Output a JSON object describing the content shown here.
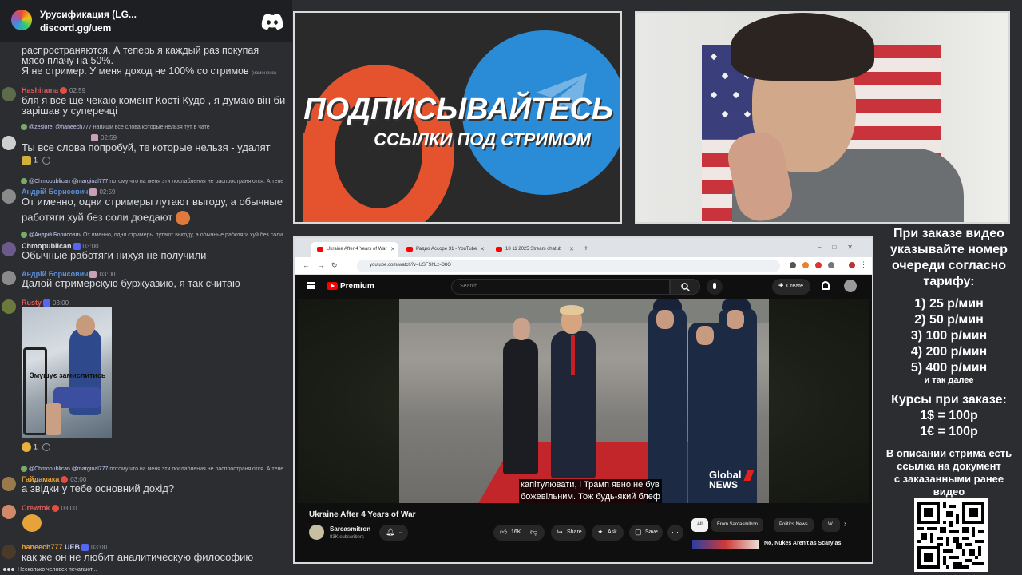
{
  "discord": {
    "server_name": "Урусификация (LG...",
    "invite": "discord.gg/uem"
  },
  "chat": {
    "cut_msg_line1": "распространяются. А теперь я каждый раз покупая",
    "cut_msg_line2": "мясо плачу на 50%.",
    "cut_msg_line3": "Я не стример. У меня доход не 100% со стримов",
    "cut_msg_edited": "(изменено)",
    "messages": [
      {
        "user": "Hashirama",
        "time": "02:59",
        "user_color": "#e05a5a",
        "text1": "бля я все ще чекаю комент Кості Кудо , я думаю він би",
        "text2": "зарішав у суперечці"
      },
      {
        "reply_user": "@zeslorel",
        "reply_mention": "@haneech777",
        "reply_text": "напиши все слова которые нельзя тут в чате",
        "time": "02:59",
        "text1": "Ты все слова попробуй, те которые нельзя - удалят",
        "reaction_count": "1"
      },
      {
        "reply_user": "@Chmopublican",
        "reply_mention": "@marginal777",
        "reply_text": "потому что на меня эти послабления не распространяются. А тепе",
        "user": "Андрій Борисович",
        "time": "02:59",
        "user_color": "#5a8fd8",
        "text1": "От именно, одни стримеры лутают выгоду, а обычные",
        "text2": "работяги хуй без соли доедают"
      },
      {
        "reply_user": "@Андрій Борисович",
        "reply_text": "От именно, одни стримеры лутают выгоду, а обычные работяги хуй без соли",
        "user": "Chmopublican",
        "time": "03:00",
        "user_color": "#dbdee1",
        "text1": "Обычные работяги нихуя не получили"
      },
      {
        "user": "Андрій Борисович",
        "time": "03:00",
        "user_color": "#5a8fd8",
        "text1": "Далой стримерскую буржуазию, я так считаю"
      },
      {
        "user": "Rusty",
        "time": "03:00",
        "user_color": "#e05a5a",
        "image_caption": "Змушує замислитись",
        "reaction_count": "1"
      },
      {
        "reply_user": "@Chmopublican",
        "reply_mention": "@marginal777",
        "reply_text": "потому что на меня эти послабления не распространяются. А тепе",
        "user": "Гайдамака",
        "time": "03:00",
        "user_color": "#e8a23a",
        "text1": "а звідки у тебе основний дохід?"
      },
      {
        "user": "Crewtok",
        "time": "03:00",
        "user_color": "#e05a5a"
      },
      {
        "user": "haneech777",
        "badge": "UEB",
        "time": "03:00",
        "user_color": "#e8a23a",
        "text1": "как же он не любит аналитическую философию"
      }
    ],
    "typing": "Несколько человек печатают..."
  },
  "promo": {
    "title": "ПОДПИСЫВАЙТЕСЬ",
    "subtitle": "ССЫЛКИ ПОД СТРИМОМ"
  },
  "browser": {
    "tabs": [
      {
        "title": "Ukraine After 4 Years of War"
      },
      {
        "title": "Радио Ассоре 31 - YouTube"
      },
      {
        "title": "18 11 2025 Stream chatub"
      }
    ],
    "url": "youtube.com/watch?v=USFShLz-O8O"
  },
  "youtube": {
    "logo_text": "Premium",
    "search_placeholder": "Search",
    "create_label": "Create",
    "subtitle_line1": "капітулювати, і Трамп явно не був",
    "subtitle_line2": "божевільним. Тож будь-який блеф",
    "watermark_line1": "Global",
    "watermark_line2": "NEWS",
    "video_title": "Ukraine After 4 Years of War",
    "channel_name": "Sarcasmitron",
    "channel_subs": "83K subscribers",
    "likes": "16K",
    "share_label": "Share",
    "ask_label": "Ask",
    "save_label": "Save",
    "chips": [
      "All",
      "From Sarcasmitron",
      "Politics News",
      "W"
    ],
    "rec_title": "No, Nukes Aren't as Scary as"
  },
  "info": {
    "line1": "При заказе видео",
    "line2": "указывайте номер",
    "line3": "очереди согласно",
    "line4": "тарифу:",
    "rates": [
      "1) 25 р/мин",
      "2) 50 р/мин",
      "3) 100 р/мин",
      "4) 200 р/мин",
      "5) 400 р/мин"
    ],
    "etc": "и так далее",
    "fx_title": "Курсы при заказе:",
    "fx1": "1$ = 100р",
    "fx2": "1€ = 100р",
    "desc1": "В описании стрима есть",
    "desc2": "ссылка на документ",
    "desc3": "с заказанными ранее",
    "desc4": "видео"
  }
}
